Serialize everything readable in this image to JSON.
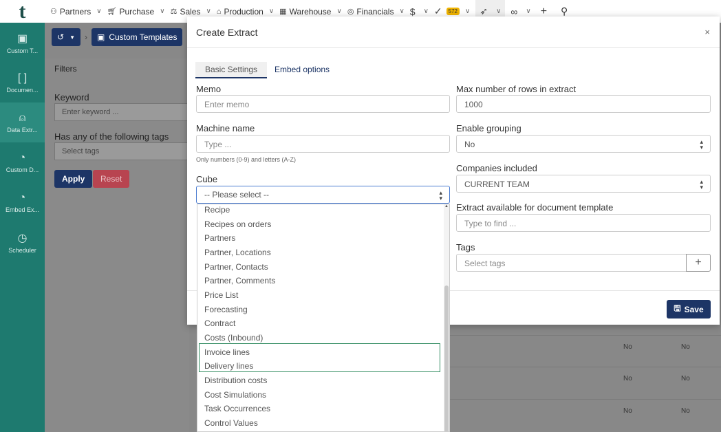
{
  "topnav": {
    "logo": "t",
    "items": [
      {
        "label": "Partners",
        "icon": "handshake-icon"
      },
      {
        "label": "Purchase",
        "icon": "cart-icon"
      },
      {
        "label": "Sales",
        "icon": "scale-icon"
      },
      {
        "label": "Production",
        "icon": "box-icon"
      },
      {
        "label": "Warehouse",
        "icon": "warehouse-icon"
      },
      {
        "label": "Financials",
        "icon": "coins-icon"
      }
    ],
    "badge": "572"
  },
  "sidebar": {
    "items": [
      {
        "label": "Custom T...",
        "icon": "document-icon"
      },
      {
        "label": "Documen...",
        "icon": "brackets-icon"
      },
      {
        "label": "Data Extr...",
        "icon": "ufo-icon"
      },
      {
        "label": "Custom D...",
        "icon": "gauge-icon"
      },
      {
        "label": "Embed Ex...",
        "icon": "gauge-icon"
      },
      {
        "label": "Scheduler",
        "icon": "clock-icon"
      }
    ]
  },
  "background": {
    "breadcrumb": "Custom Templates",
    "filters_title": "Filters",
    "keyword_label": "Keyword",
    "keyword_placeholder": "Enter keyword ...",
    "tags_label": "Has any of the following tags",
    "tags_placeholder": "Select tags",
    "apply": "Apply",
    "reset": "Reset",
    "cells": [
      "No",
      "No",
      "No",
      "No",
      "No",
      "No"
    ]
  },
  "modal": {
    "title": "Create Extract",
    "close": "×",
    "tabs": [
      "Basic Settings",
      "Embed options"
    ],
    "memo_label": "Memo",
    "memo_placeholder": "Enter memo",
    "machine_label": "Machine name",
    "machine_placeholder": "Type ...",
    "machine_hint": "Only numbers (0-9) and letters (A-Z)",
    "cube_label": "Cube",
    "cube_value": "-- Please select --",
    "maxrows_label": "Max number of rows in extract",
    "maxrows_value": "1000",
    "grouping_label": "Enable grouping",
    "grouping_value": "No",
    "companies_label": "Companies included",
    "companies_value": "CURRENT TEAM",
    "doctemplate_label": "Extract available for document template",
    "doctemplate_placeholder": "Type to find ...",
    "tags_label": "Tags",
    "tags_placeholder": "Select tags",
    "save": "Save"
  },
  "cube_options": [
    "Recipe",
    "Recipes on orders",
    "Partners",
    "Partner, Locations",
    "Partner, Contacts",
    "Partner, Comments",
    "Price List",
    "Forecasting",
    "Contract",
    "Costs (Inbound)",
    "Invoice lines",
    "Delivery lines",
    "Distribution costs",
    "Cost Simulations",
    "Task Occurrences",
    "Control Values"
  ]
}
